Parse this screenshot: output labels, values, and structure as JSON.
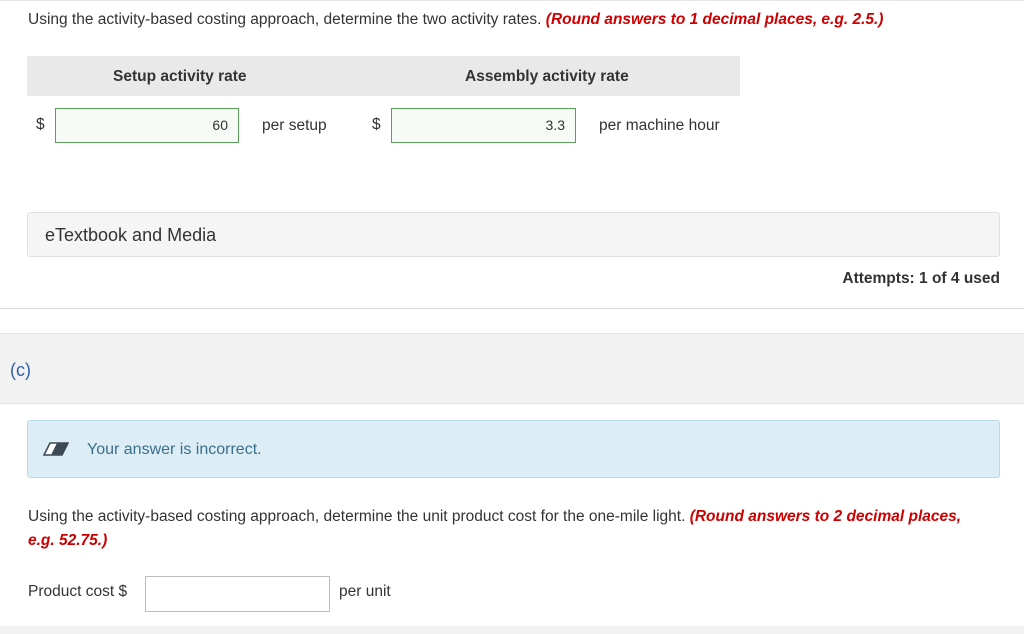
{
  "part_b": {
    "question": "Using the activity-based costing approach, determine the two activity rates.",
    "rounding_note": "(Round answers to 1 decimal places, e.g. 2.5.)",
    "headers": {
      "setup": "Setup activity rate",
      "assembly": "Assembly activity rate"
    },
    "setup": {
      "currency": "$",
      "value": "60",
      "unit": "per setup"
    },
    "assembly": {
      "currency": "$",
      "value": "3.3",
      "unit": "per machine hour"
    },
    "etextbook_label": "eTextbook and Media",
    "attempts": "Attempts: 1 of 4 used"
  },
  "part_c": {
    "label": "(c)",
    "feedback": "Your answer is incorrect.",
    "question": "Using the activity-based costing approach, determine the unit product cost for the one-mile light.",
    "rounding_note": "(Round answers to 2 decimal places, e.g. 52.75.)",
    "product_cost_label": "Product cost $",
    "product_cost_value": "",
    "unit": "per unit"
  },
  "colors": {
    "warning_text": "#cc0000",
    "correct_border": "#5a9e5a",
    "feedback_bg": "#dcedf5",
    "part_label": "#2f5fa7"
  },
  "icons": {
    "feedback": "eraser-icon"
  }
}
